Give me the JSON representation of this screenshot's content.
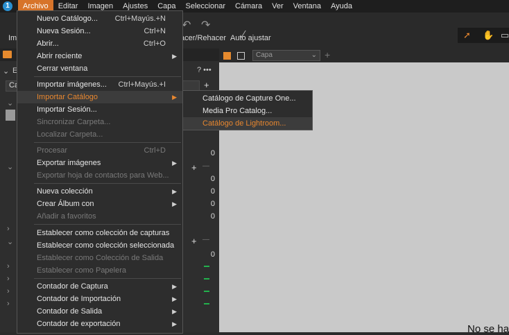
{
  "menubar": {
    "logo_glyph": "1",
    "items": [
      "Archivo",
      "Editar",
      "Imagen",
      "Ajustes",
      "Capa",
      "Seleccionar",
      "Cámara",
      "Ver",
      "Ventana",
      "Ayuda"
    ]
  },
  "toolbar": {
    "left_label": "Im",
    "undo_label": "acer/Rehacer",
    "auto_adjust_label": "Auto ajustar",
    "icons": [
      "undo-icon",
      "redo-icon",
      "magic-wand-icon",
      "cursor-tool-icon",
      "hand-tool-icon",
      "crop-tool-icon"
    ]
  },
  "left_panel": {
    "header_letter": "E",
    "header_icons": "? •••",
    "select_label": "Ca",
    "counts": [
      "0",
      "0",
      "0",
      "0",
      "0",
      "0",
      "0"
    ],
    "plus": "+",
    "minus": "—"
  },
  "viewer": {
    "layer_select": "Capa",
    "message": "No se ha"
  },
  "file_menu": {
    "items": [
      {
        "label": "Nuevo Catálogo...",
        "shortcut": "Ctrl+Mayús.+N"
      },
      {
        "label": "Nueva Sesión...",
        "shortcut": "Ctrl+N"
      },
      {
        "label": "Abrir...",
        "shortcut": "Ctrl+O"
      },
      {
        "label": "Abrir reciente",
        "submenu": true
      },
      {
        "label": "Cerrar ventana"
      },
      {
        "label": "Importar imágenes...",
        "shortcut": "Ctrl+Mayús.+I"
      },
      {
        "label": "Importar Catálogo",
        "submenu": true,
        "highlight": true
      },
      {
        "label": "Importar Sesión..."
      },
      {
        "label": "Sincronizar Carpeta...",
        "disabled": true
      },
      {
        "label": "Localizar Carpeta...",
        "disabled": true
      },
      {
        "label": "Procesar",
        "shortcut": "Ctrl+D",
        "disabled": true
      },
      {
        "label": "Exportar imágenes",
        "submenu": true
      },
      {
        "label": "Exportar hoja de contactos para Web...",
        "disabled": true
      },
      {
        "label": "Nueva colección",
        "submenu": true
      },
      {
        "label": "Crear Álbum con",
        "submenu": true
      },
      {
        "label": "Añadir a favoritos",
        "disabled": true
      },
      {
        "label": "Establecer como colección de capturas"
      },
      {
        "label": "Establecer como colección seleccionada"
      },
      {
        "label": "Establecer como Colección de Salida",
        "disabled": true
      },
      {
        "label": "Establecer como Papelera",
        "disabled": true
      },
      {
        "label": "Contador de Captura",
        "submenu": true
      },
      {
        "label": "Contador de Importación",
        "submenu": true
      },
      {
        "label": "Contador de Salida",
        "submenu": true
      },
      {
        "label": "Contador de exportación",
        "submenu": true
      }
    ]
  },
  "import_submenu": {
    "items": [
      {
        "label": "Catálogo de Capture One..."
      },
      {
        "label": "Media Pro Catalog..."
      },
      {
        "label": "Catálogo de Lightroom...",
        "highlight": true
      }
    ]
  }
}
